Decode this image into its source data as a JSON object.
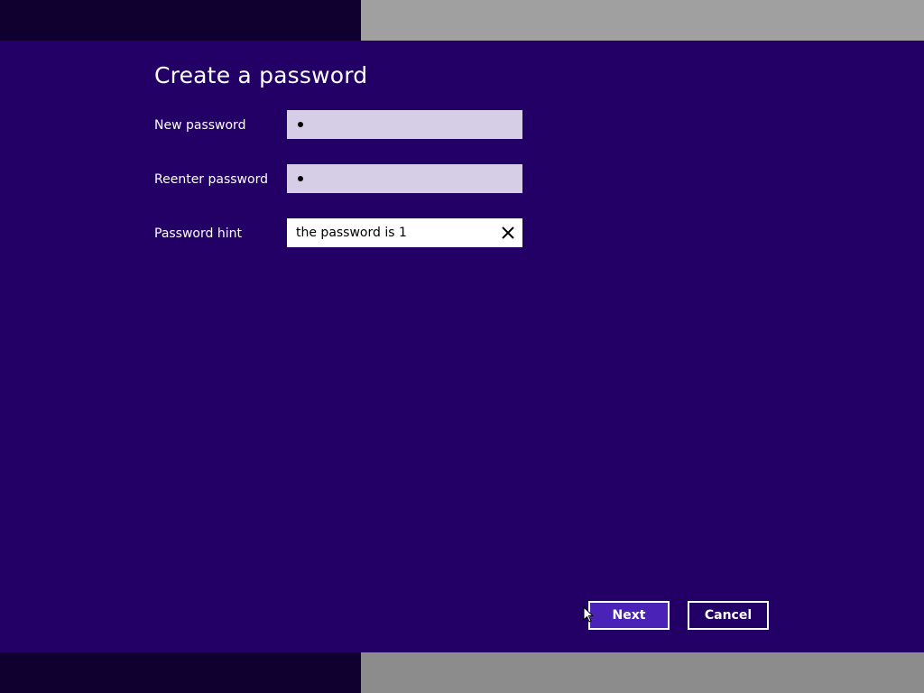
{
  "dialog": {
    "title": "Create a password"
  },
  "form": {
    "new_password_label": "New password",
    "new_password_value": "•",
    "reenter_password_label": "Reenter password",
    "reenter_password_value": "•",
    "hint_label": "Password hint",
    "hint_value": "the password is 1"
  },
  "buttons": {
    "next_label": "Next",
    "cancel_label": "Cancel"
  },
  "colors": {
    "background": "#230066",
    "password_field": "#d6cde6",
    "next_button": "#4a22b8"
  },
  "icons": {
    "clear": "close-icon",
    "pointer": "mouse-cursor-icon"
  }
}
